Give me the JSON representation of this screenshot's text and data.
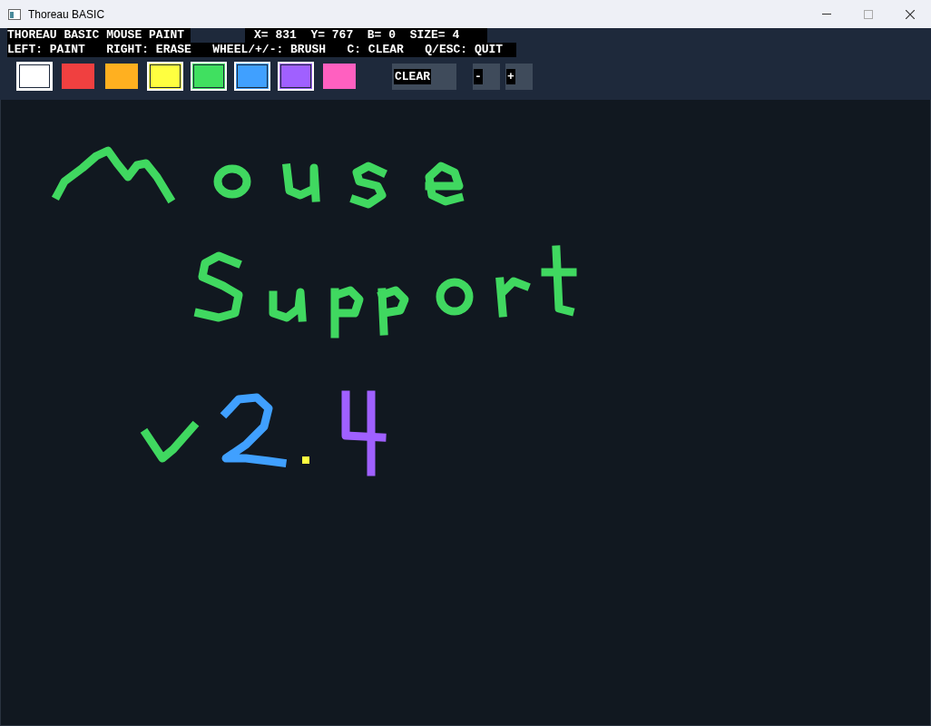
{
  "window": {
    "title": "Thoreau BASIC"
  },
  "status": {
    "title": "THOREAU BASIC MOUSE PAINT",
    "readout": "X= 831  Y= 767  B= 0  SIZE= 4",
    "help": "LEFT: PAINT   RIGHT: ERASE   WHEEL/+/-: BRUSH   C: CLEAR   Q/ESC: QUIT"
  },
  "palette": [
    {
      "color": "#ffffff",
      "outlined": true
    },
    {
      "color": "#f04040",
      "outlined": false
    },
    {
      "color": "#ffb020",
      "outlined": false
    },
    {
      "color": "#ffff40",
      "outlined": true
    },
    {
      "color": "#40e060",
      "outlined": true
    },
    {
      "color": "#40a0ff",
      "outlined": true
    },
    {
      "color": "#a060ff",
      "outlined": true
    },
    {
      "color": "#ff60c0",
      "outlined": false
    }
  ],
  "buttons": [
    {
      "kind": "clear",
      "label": "CLEAR"
    },
    {
      "kind": "minus",
      "label": "-"
    },
    {
      "kind": "plus",
      "label": "+"
    }
  ]
}
